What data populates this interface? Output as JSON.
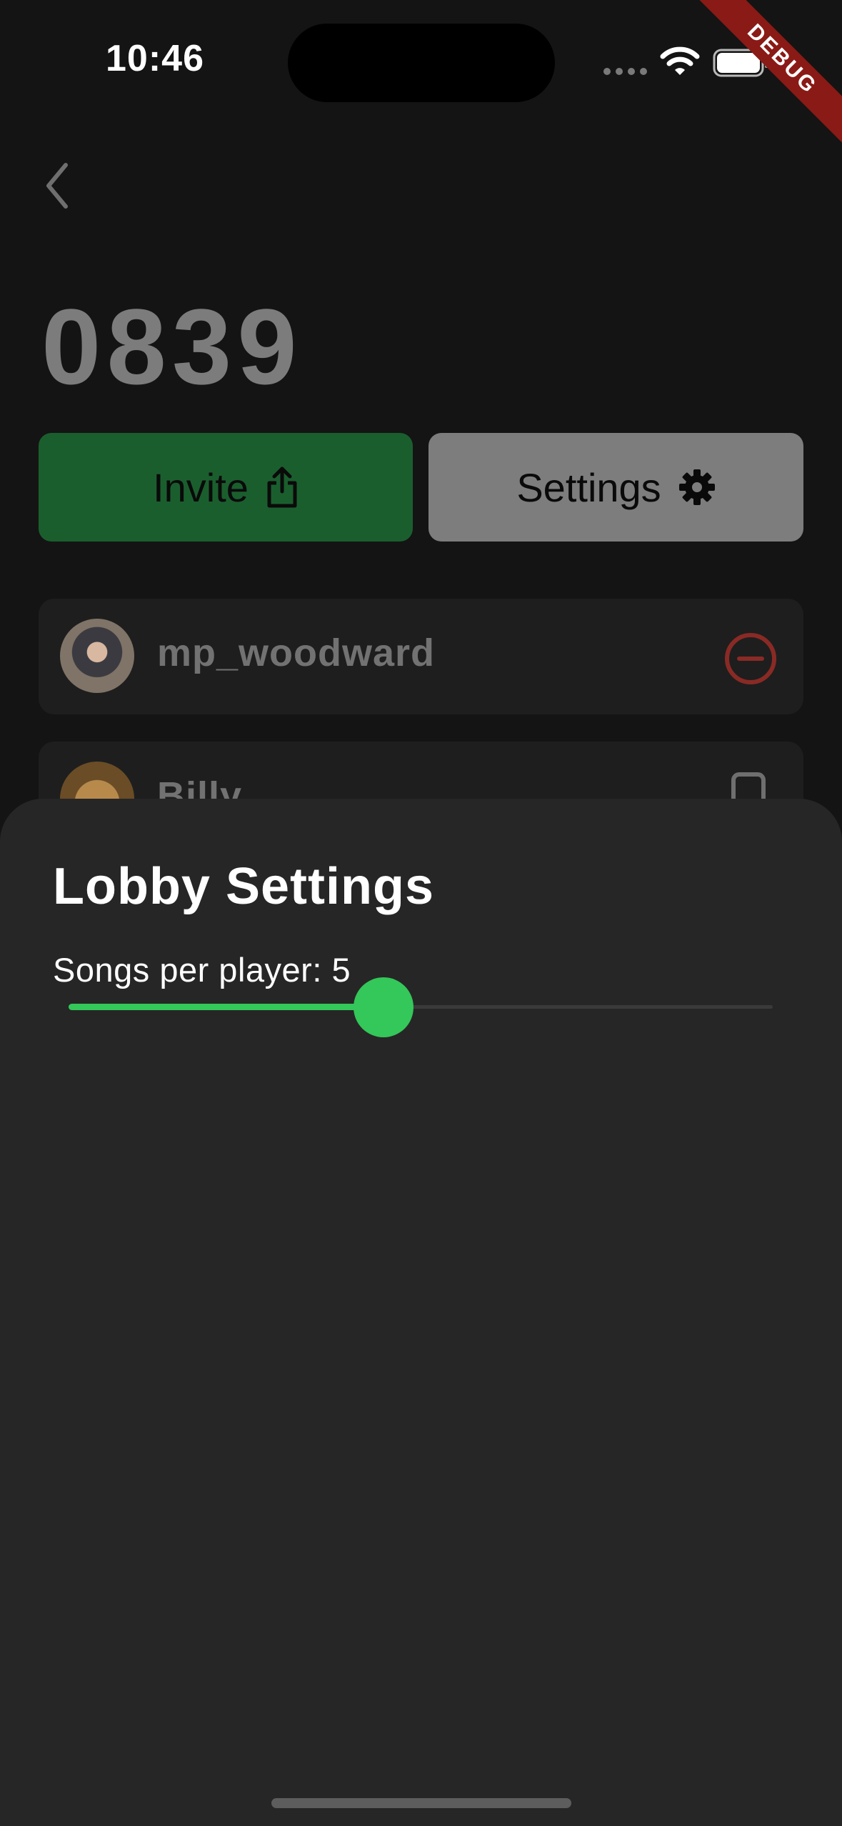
{
  "status_bar": {
    "time": "10:46"
  },
  "debug_banner": {
    "label": "DEBUG"
  },
  "lobby": {
    "code": "0839",
    "invite_label": "Invite",
    "invite_icon": "share-icon",
    "settings_label": "Settings",
    "settings_icon": "gear-icon",
    "players": [
      {
        "name": "mp_woodward",
        "action_icon": "remove-circle-icon"
      },
      {
        "name": "Billy",
        "action_icon": "phone-device-icon"
      }
    ]
  },
  "sheet": {
    "title": "Lobby Settings",
    "songs_label": "Songs per player: 5",
    "slider_fraction": 0.447
  },
  "colors": {
    "accent_green": "#34c759",
    "invite_green": "#1b5e2e",
    "remove_red": "#8a2a25",
    "sheet_bg": "#262626"
  }
}
